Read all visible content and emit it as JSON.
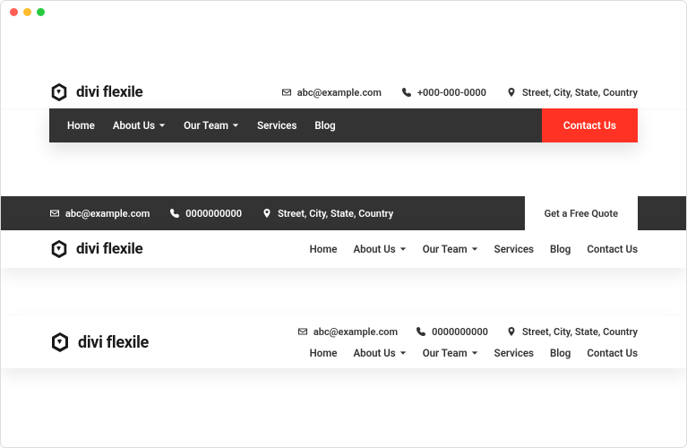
{
  "brand": "divi flexile",
  "contact": {
    "email": "abc@example.com",
    "phone1": "+000-000-0000",
    "phone2": "0000000000",
    "address": "Street, City, State, Country"
  },
  "nav": {
    "home": "Home",
    "about": "About Us",
    "team": "Our Team",
    "services": "Services",
    "blog": "Blog",
    "contact": "Contact Us"
  },
  "cta": {
    "contact": "Contact Us",
    "quote": "Get a Free Quote"
  }
}
